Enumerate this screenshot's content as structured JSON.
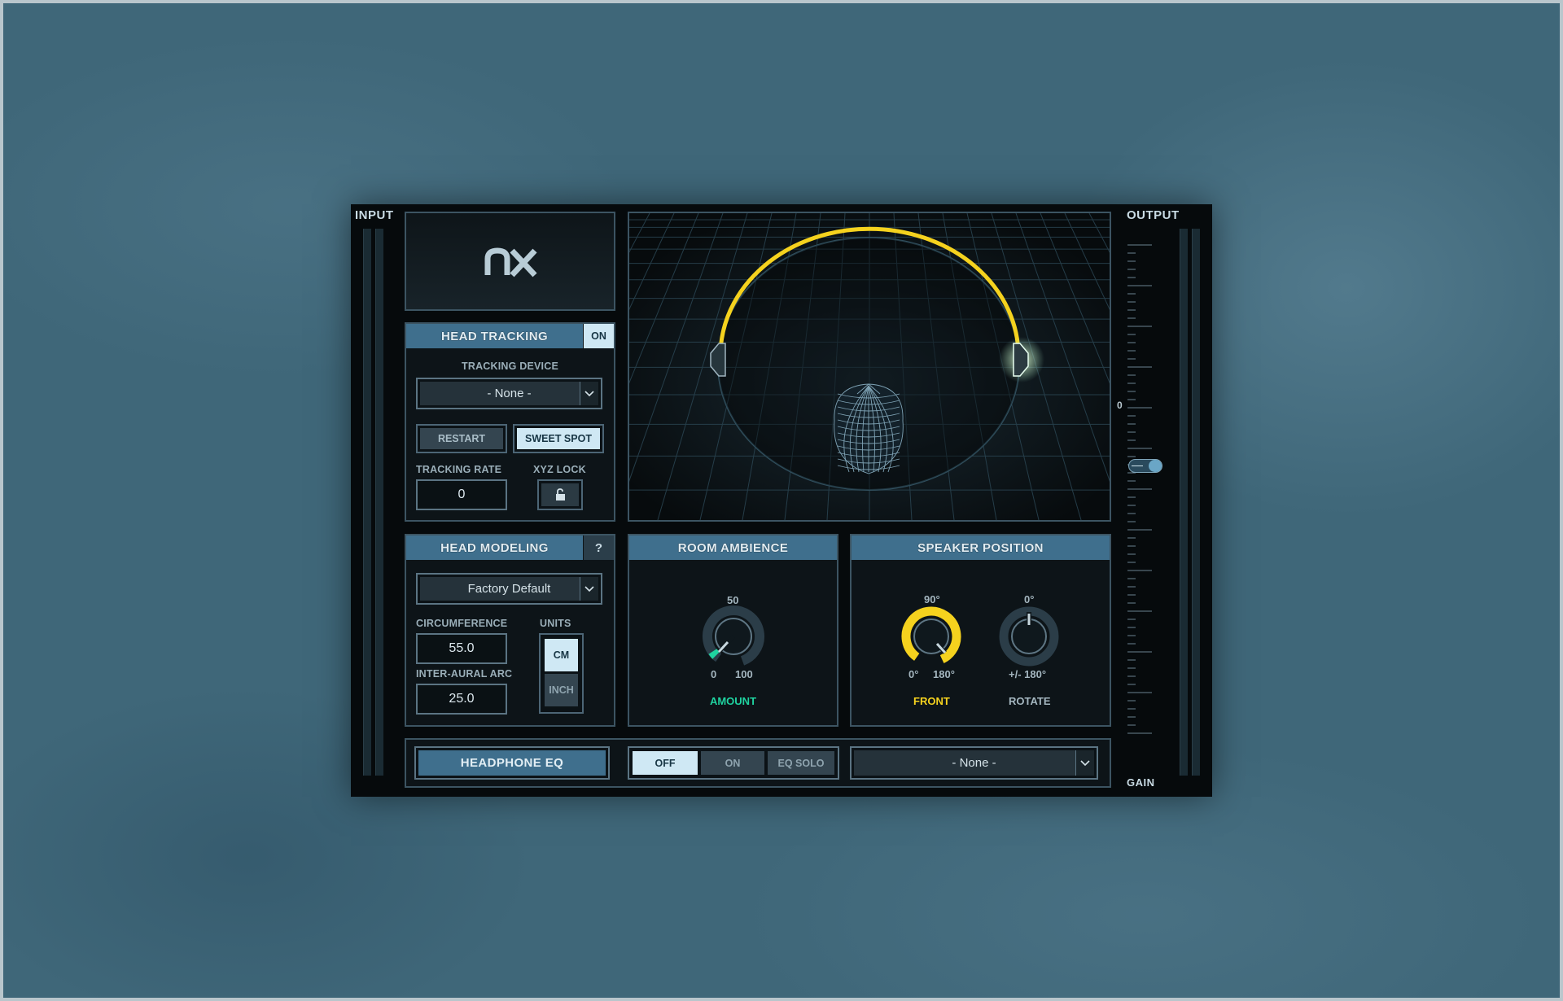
{
  "meters": {
    "input_label": "INPUT",
    "output_label": "OUTPUT",
    "gain_label": "GAIN",
    "output_scale_zero": "0"
  },
  "logo": {
    "text": "nx"
  },
  "head_tracking": {
    "title": "HEAD TRACKING",
    "toggle": "ON",
    "tracking_device_label": "TRACKING DEVICE",
    "tracking_device_value": "- None -",
    "restart_label": "RESTART",
    "sweet_spot_label": "SWEET SPOT",
    "tracking_rate_label": "TRACKING RATE",
    "tracking_rate_value": "0",
    "xyz_lock_label": "XYZ LOCK"
  },
  "head_modeling": {
    "title": "HEAD MODELING",
    "help": "?",
    "preset_value": "Factory Default",
    "circumference_label": "CIRCUMFERENCE",
    "circumference_value": "55.0",
    "inter_aural_label": "INTER-AURAL  ARC",
    "inter_aural_value": "25.0",
    "units_label": "UNITS",
    "unit_cm": "CM",
    "unit_inch": "INCH",
    "selected_unit": "CM"
  },
  "room_ambience": {
    "title": "ROOM AMBIENCE",
    "mid_label": "50",
    "min_label": "0",
    "max_label": "100",
    "knob_label": "AMOUNT",
    "knob_color": "#1fd3a0"
  },
  "speaker_position": {
    "title": "SPEAKER POSITION",
    "front_top_label": "90°",
    "front_min_label": "0°",
    "front_max_label": "180°",
    "front_knob_label": "FRONT",
    "front_color": "#f5d21e",
    "rotate_top_label": "0°",
    "rotate_range_label": "+/- 180°",
    "rotate_knob_label": "ROTATE"
  },
  "headphone_eq": {
    "title": "HEADPHONE EQ",
    "off_label": "OFF",
    "on_label": "ON",
    "eq_solo_label": "EQ SOLO",
    "selected": "OFF",
    "model_value": "- None -"
  },
  "colors": {
    "accent": "#3f6f8d",
    "arc_yellow": "#f5d21e",
    "active_button": "#cfe8f4"
  }
}
